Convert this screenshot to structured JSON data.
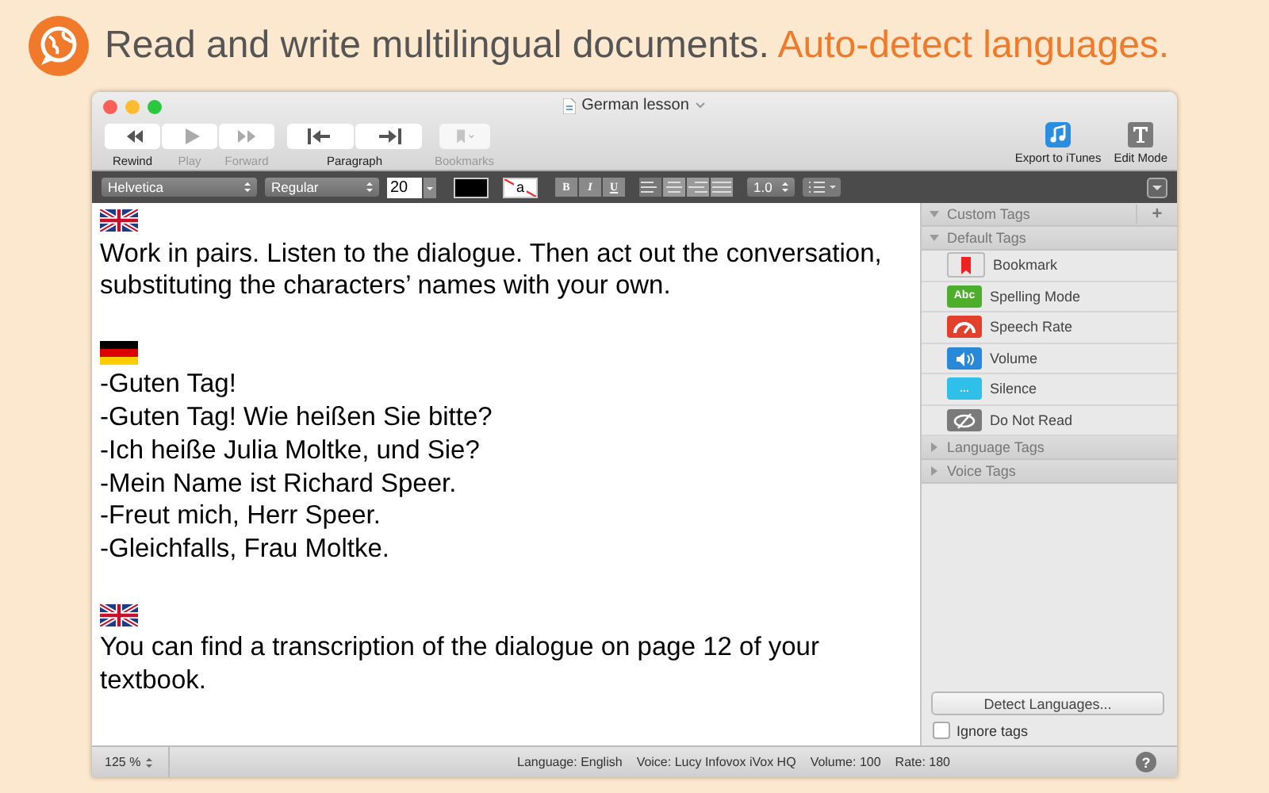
{
  "headline": {
    "text": "Read and write multilingual documents.",
    "accent": "Auto-detect languages."
  },
  "window": {
    "title": "German lesson"
  },
  "toolbar": {
    "groups": [
      {
        "label": "Rewind",
        "buttons": [
          {
            "kind": "rewind",
            "disabled": false
          }
        ]
      },
      {
        "label": "Play",
        "buttons": [
          {
            "kind": "play",
            "disabled": true
          }
        ]
      },
      {
        "label": "Forward",
        "buttons": [
          {
            "kind": "forward",
            "disabled": true
          }
        ]
      },
      {
        "label": "Paragraph",
        "buttons": [
          {
            "kind": "prev-paragraph",
            "disabled": false
          },
          {
            "kind": "next-paragraph",
            "disabled": false
          }
        ]
      },
      {
        "label": "Bookmarks",
        "buttons": [
          {
            "kind": "bookmark",
            "disabled": true
          }
        ]
      }
    ],
    "right": [
      {
        "kind": "itunes",
        "label": "Export to iTunes"
      },
      {
        "kind": "edit",
        "label": "Edit Mode"
      }
    ]
  },
  "format_bar": {
    "font": "Helvetica",
    "style": "Regular",
    "size": "20",
    "bold": "B",
    "italic": "I",
    "underline": "U",
    "background_letter": "a",
    "line_spacing": "1.0"
  },
  "document": [
    {
      "kind": "uk-flag",
      "lines": [
        "Work in pairs. Listen to the dialogue. Then act out the conversation, substituting the characters’ names with your own."
      ]
    },
    {
      "kind": "de-flag",
      "lines": [
        "-Guten Tag!",
        "-Guten Tag! Wie heißen Sie bitte?",
        "-Ich heiße Julia Moltke, und Sie?",
        "-Mein Name ist Richard Speer.",
        "-Freut mich, Herr Speer.",
        "-Gleichfalls, Frau Moltke."
      ]
    },
    {
      "kind": "uk-flag",
      "lines": [
        "You can find a transcription of the dialogue on page 12 of your textbook."
      ]
    }
  ],
  "sidebar": {
    "sections": [
      {
        "title": "Custom Tags",
        "expanded": true,
        "add": "+"
      },
      {
        "title": "Default Tags",
        "expanded": true,
        "items": [
          {
            "kind": "bookmark",
            "label": "Bookmark",
            "color": "#e8e8e8"
          },
          {
            "kind": "abc",
            "label": "Spelling Mode",
            "color": "#4cae2a",
            "icon_text": "Abc"
          },
          {
            "kind": "gauge",
            "label": "Speech Rate",
            "color": "#e2402c"
          },
          {
            "kind": "speaker",
            "label": "Volume",
            "color": "#2a88d8"
          },
          {
            "kind": "dots",
            "label": "Silence",
            "color": "#2ec0e8",
            "icon_text": "..."
          },
          {
            "kind": "eye",
            "label": "Do Not Read",
            "color": "#7a7a7a"
          }
        ]
      },
      {
        "title": "Language Tags",
        "expanded": false
      },
      {
        "title": "Voice Tags",
        "expanded": false
      }
    ],
    "detect_button": "Detect Languages...",
    "ignore_tags": {
      "label": "Ignore tags",
      "checked": false
    }
  },
  "status_bar": {
    "zoom": "125 %",
    "language": "Language: English",
    "voice": "Voice: Lucy Infovox iVox HQ",
    "volume": "Volume: 100",
    "rate": "Rate: 180",
    "help": "?"
  }
}
